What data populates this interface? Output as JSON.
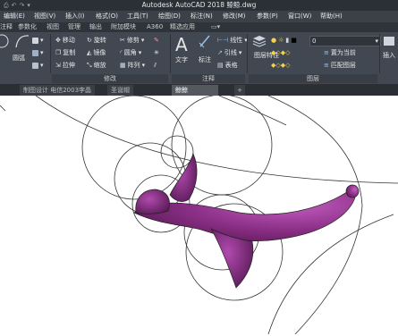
{
  "titlebar": {
    "title": "Autodesk AutoCAD 2018   鲸鲸.dwg"
  },
  "menubar": {
    "items": [
      "编辑(E)",
      "视图(V)",
      "插入(I)",
      "格式(O)",
      "工具(T)",
      "绘图(D)",
      "标注(N)",
      "修改(M)",
      "参数(P)",
      "窗口(W)",
      "帮助(H)"
    ]
  },
  "ribbon_tabs": [
    "注释",
    "参数化",
    "视图",
    "管理",
    "输出",
    "附加模块",
    "A360",
    "精选应用"
  ],
  "ribbon": {
    "draw_label": "圆弧",
    "modify_tools": [
      "移动",
      "旋转",
      "修剪",
      "复制",
      "镜像",
      "圆角",
      "拉伸",
      "缩放",
      "阵列"
    ],
    "modify_title": "修改",
    "annot_tools": {
      "text": "文字",
      "dim": "标注",
      "linear": "线性",
      "leader": "引线",
      "table": "表格"
    },
    "annot_title": "注释",
    "layer_tools": {
      "props": "图层特性",
      "current_layer": "0",
      "set_current": "置为当前",
      "match": "匹配图层"
    },
    "layer_title": "图层",
    "insert": "插入"
  },
  "doc_tabs": [
    "制图设计  电信2003李晶",
    "圣诞帽",
    "鲸鲸"
  ],
  "colors": {
    "whale_fill": "#8b2f86",
    "whale_highlight": "#c25dc0",
    "ribbon_bg": "#424852",
    "menubar_bg": "#3b4049"
  }
}
